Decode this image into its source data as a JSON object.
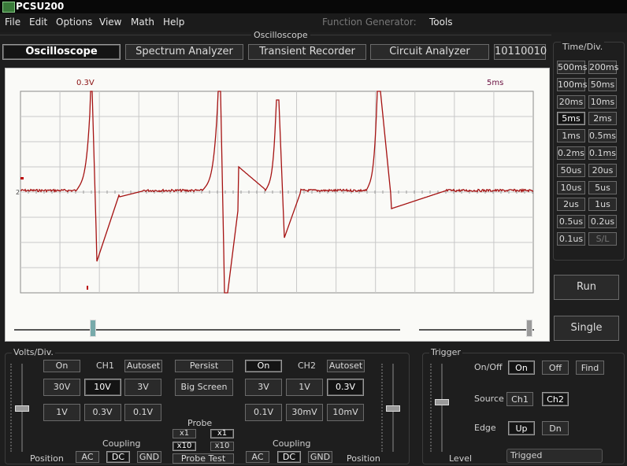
{
  "window": {
    "title": "PCSU200"
  },
  "menu": {
    "file": "File",
    "edit": "Edit",
    "options": "Options",
    "view": "View",
    "math": "Math",
    "help": "Help",
    "function_generator": "Function Generator:",
    "tools": "Tools"
  },
  "section_label": "Oscilloscope",
  "tabs": {
    "oscilloscope": "Oscilloscope",
    "spectrum": "Spectrum Analyzer",
    "transient": "Transient Recorder",
    "circuit": "Circuit Analyzer",
    "binary": "10110010"
  },
  "scope": {
    "ch_scale": "0.3V",
    "time_scale": "5ms",
    "marker": "2"
  },
  "timediv": {
    "title": "Time/Div.",
    "selected": "5ms",
    "buttons": [
      "500ms",
      "200ms",
      "100ms",
      "50ms",
      "20ms",
      "10ms",
      "5ms",
      "2ms",
      "1ms",
      "0.5ms",
      "0.2ms",
      "0.1ms",
      "50us",
      "20us",
      "10us",
      "5us",
      "2us",
      "1us",
      "0.5us",
      "0.2us",
      "0.1us",
      "S/L"
    ]
  },
  "controls": {
    "run": "Run",
    "single": "Single"
  },
  "volts": {
    "title": "Volts/Div.",
    "ch1": {
      "label": "CH1",
      "on": "On",
      "autoset": "Autoset",
      "buttons": [
        "30V",
        "10V",
        "3V",
        "1V",
        "0.3V",
        "0.1V"
      ],
      "selected": "10V"
    },
    "ch2": {
      "label": "CH2",
      "on": "On",
      "autoset": "Autoset",
      "buttons": [
        "3V",
        "1V",
        "0.3V",
        "0.1V",
        "30mV",
        "10mV"
      ],
      "selected": "0.3V"
    },
    "persist": "Persist",
    "big_screen": "Big Screen",
    "probe": "Probe",
    "probe_x1": "x1",
    "probe_x10": "x10",
    "probe_test": "Probe Test",
    "coupling": "Coupling",
    "ac": "AC",
    "dc": "DC",
    "gnd": "GND",
    "position": "Position"
  },
  "trigger": {
    "title": "Trigger",
    "onoff_label": "On/Off",
    "on": "On",
    "off": "Off",
    "find": "Find",
    "source_label": "Source",
    "ch1": "Ch1",
    "ch2": "Ch2",
    "edge_label": "Edge",
    "up": "Up",
    "dn": "Dn",
    "level": "Level",
    "status": "Trigged"
  }
}
